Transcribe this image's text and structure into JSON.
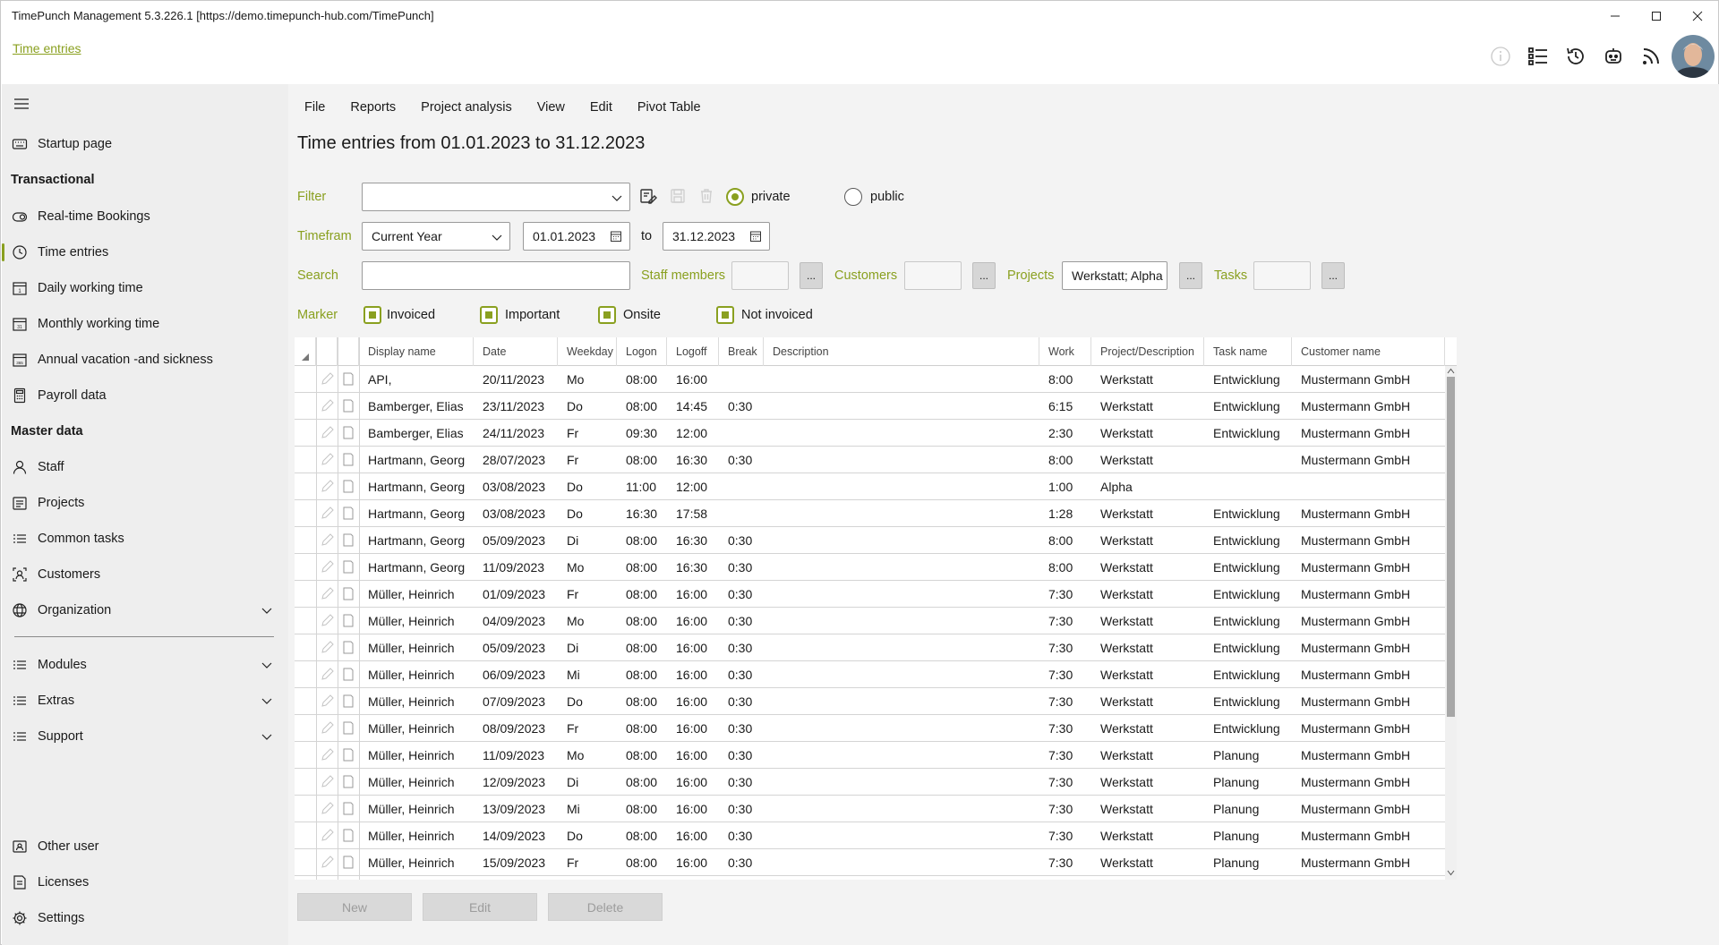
{
  "window": {
    "title": "TimePunch Management 5.3.226.1 [https://demo.timepunch-hub.com/TimePunch]"
  },
  "breadcrumb": "Time entries",
  "sidebar": {
    "items": [
      {
        "label": "Startup page",
        "icon": "keyboard-icon"
      },
      {
        "label": "Real-time Bookings",
        "icon": "toggle-icon"
      },
      {
        "label": "Time entries",
        "icon": "clock-icon",
        "active": true
      },
      {
        "label": "Daily working time",
        "icon": "calendar-day-icon"
      },
      {
        "label": "Monthly working time",
        "icon": "calendar-month-icon"
      },
      {
        "label": "Annual vacation -and sickness",
        "icon": "calendar-year-icon"
      },
      {
        "label": "Payroll data",
        "icon": "calculator-icon"
      },
      {
        "label": "Staff",
        "icon": "person-icon"
      },
      {
        "label": "Projects",
        "icon": "project-icon"
      },
      {
        "label": "Common tasks",
        "icon": "list-icon"
      },
      {
        "label": "Customers",
        "icon": "customer-icon"
      },
      {
        "label": "Organization",
        "icon": "globe-icon"
      },
      {
        "label": "Modules",
        "icon": "list-icon"
      },
      {
        "label": "Extras",
        "icon": "list-icon"
      },
      {
        "label": "Support",
        "icon": "list-icon"
      },
      {
        "label": "Other user",
        "icon": "switch-user-icon"
      },
      {
        "label": "Licenses",
        "icon": "license-icon"
      },
      {
        "label": "Settings",
        "icon": "gear-icon"
      }
    ],
    "sections": {
      "transactional": "Transactional",
      "master_data": "Master data"
    }
  },
  "menu": [
    "File",
    "Reports",
    "Project analysis",
    "View",
    "Edit",
    "Pivot Table"
  ],
  "page_title": "Time entries from 01.01.2023 to 31.12.2023",
  "filter": {
    "label": "Filter",
    "value": "",
    "private_label": "private",
    "public_label": "public",
    "selected": "private"
  },
  "timeframe": {
    "label": "Timeframe",
    "value": "Current Year",
    "from": "01.01.2023",
    "to_label": "to",
    "to": "31.12.2023"
  },
  "search": {
    "label": "Search",
    "value": ""
  },
  "staff": {
    "label": "Staff members",
    "value": "",
    "btn": "..."
  },
  "customers": {
    "label": "Customers",
    "value": "",
    "btn": "..."
  },
  "projects": {
    "label": "Projects",
    "value": "Werkstatt; Alpha",
    "btn": "..."
  },
  "tasks": {
    "label": "Tasks",
    "value": "",
    "btn": "..."
  },
  "marker": {
    "label": "Marker",
    "items": [
      "Invoiced",
      "Important",
      "Onsite",
      "Not invoiced"
    ]
  },
  "table": {
    "columns": [
      "Display name",
      "Date",
      "Weekday",
      "Logon",
      "Logoff",
      "Break",
      "Description",
      "Work",
      "Project/Description",
      "Task name",
      "Customer name"
    ],
    "rows": [
      [
        "API,",
        "20/11/2023",
        "Mo",
        "08:00",
        "16:00",
        "",
        "",
        "8:00",
        "Werkstatt",
        "Entwicklung",
        "Mustermann GmbH"
      ],
      [
        "Bamberger, Elias",
        "23/11/2023",
        "Do",
        "08:00",
        "14:45",
        "0:30",
        "",
        "6:15",
        "Werkstatt",
        "Entwicklung",
        "Mustermann GmbH"
      ],
      [
        "Bamberger, Elias",
        "24/11/2023",
        "Fr",
        "09:30",
        "12:00",
        "",
        "",
        "2:30",
        "Werkstatt",
        "Entwicklung",
        "Mustermann GmbH"
      ],
      [
        "Hartmann, Georg",
        "28/07/2023",
        "Fr",
        "08:00",
        "16:30",
        "0:30",
        "",
        "8:00",
        "Werkstatt",
        "",
        "Mustermann GmbH"
      ],
      [
        "Hartmann, Georg",
        "03/08/2023",
        "Do",
        "11:00",
        "12:00",
        "",
        "",
        "1:00",
        "Alpha",
        "",
        ""
      ],
      [
        "Hartmann, Georg",
        "03/08/2023",
        "Do",
        "16:30",
        "17:58",
        "",
        "",
        "1:28",
        "Werkstatt",
        "Entwicklung",
        "Mustermann GmbH"
      ],
      [
        "Hartmann, Georg",
        "05/09/2023",
        "Di",
        "08:00",
        "16:30",
        "0:30",
        "",
        "8:00",
        "Werkstatt",
        "Entwicklung",
        "Mustermann GmbH"
      ],
      [
        "Hartmann, Georg",
        "11/09/2023",
        "Mo",
        "08:00",
        "16:30",
        "0:30",
        "",
        "8:00",
        "Werkstatt",
        "Entwicklung",
        "Mustermann GmbH"
      ],
      [
        "Müller, Heinrich",
        "01/09/2023",
        "Fr",
        "08:00",
        "16:00",
        "0:30",
        "",
        "7:30",
        "Werkstatt",
        "Entwicklung",
        "Mustermann GmbH"
      ],
      [
        "Müller, Heinrich",
        "04/09/2023",
        "Mo",
        "08:00",
        "16:00",
        "0:30",
        "",
        "7:30",
        "Werkstatt",
        "Entwicklung",
        "Mustermann GmbH"
      ],
      [
        "Müller, Heinrich",
        "05/09/2023",
        "Di",
        "08:00",
        "16:00",
        "0:30",
        "",
        "7:30",
        "Werkstatt",
        "Entwicklung",
        "Mustermann GmbH"
      ],
      [
        "Müller, Heinrich",
        "06/09/2023",
        "Mi",
        "08:00",
        "16:00",
        "0:30",
        "",
        "7:30",
        "Werkstatt",
        "Entwicklung",
        "Mustermann GmbH"
      ],
      [
        "Müller, Heinrich",
        "07/09/2023",
        "Do",
        "08:00",
        "16:00",
        "0:30",
        "",
        "7:30",
        "Werkstatt",
        "Entwicklung",
        "Mustermann GmbH"
      ],
      [
        "Müller, Heinrich",
        "08/09/2023",
        "Fr",
        "08:00",
        "16:00",
        "0:30",
        "",
        "7:30",
        "Werkstatt",
        "Entwicklung",
        "Mustermann GmbH"
      ],
      [
        "Müller, Heinrich",
        "11/09/2023",
        "Mo",
        "08:00",
        "16:00",
        "0:30",
        "",
        "7:30",
        "Werkstatt",
        "Planung",
        "Mustermann GmbH"
      ],
      [
        "Müller, Heinrich",
        "12/09/2023",
        "Di",
        "08:00",
        "16:00",
        "0:30",
        "",
        "7:30",
        "Werkstatt",
        "Planung",
        "Mustermann GmbH"
      ],
      [
        "Müller, Heinrich",
        "13/09/2023",
        "Mi",
        "08:00",
        "16:00",
        "0:30",
        "",
        "7:30",
        "Werkstatt",
        "Planung",
        "Mustermann GmbH"
      ],
      [
        "Müller, Heinrich",
        "14/09/2023",
        "Do",
        "08:00",
        "16:00",
        "0:30",
        "",
        "7:30",
        "Werkstatt",
        "Planung",
        "Mustermann GmbH"
      ],
      [
        "Müller, Heinrich",
        "15/09/2023",
        "Fr",
        "08:00",
        "16:00",
        "0:30",
        "",
        "7:30",
        "Werkstatt",
        "Planung",
        "Mustermann GmbH"
      ]
    ]
  },
  "buttons": {
    "new": "New",
    "edit": "Edit",
    "delete": "Delete"
  },
  "colors": {
    "accent": "#8aa020",
    "sidebar_bg": "#eeeeee",
    "main_bg": "#f3f3f3"
  }
}
